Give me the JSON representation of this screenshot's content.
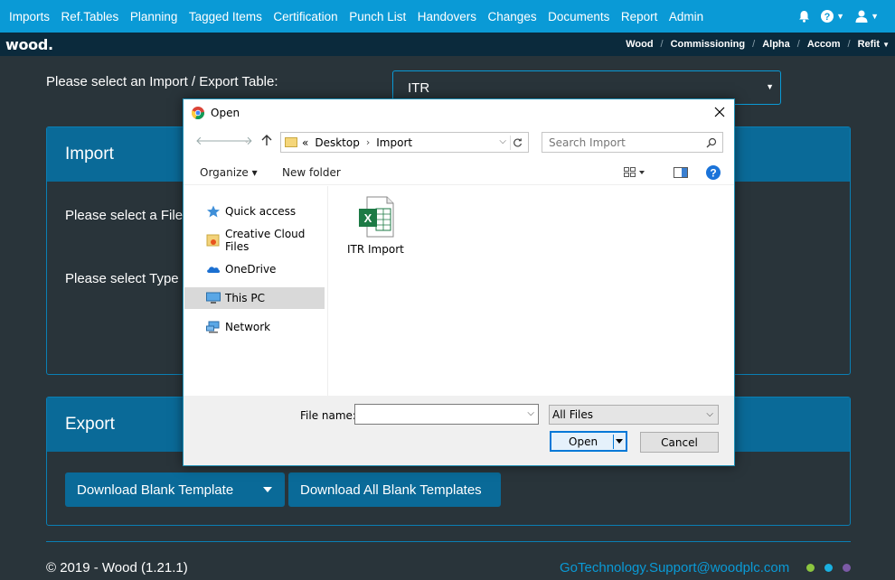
{
  "topnav": {
    "items": [
      "Imports",
      "Ref.Tables",
      "Planning",
      "Tagged Items",
      "Certification",
      "Punch List",
      "Handovers",
      "Changes",
      "Documents",
      "Report",
      "Admin"
    ]
  },
  "subnav": {
    "logo": "wood.",
    "breadcrumbs": [
      "Wood",
      "Commissioning",
      "Alpha",
      "Accom",
      "Refit"
    ]
  },
  "page": {
    "select_label": "Please select an Import / Export Table:",
    "select_value": "ITR",
    "import": {
      "title": "Import",
      "line1": "Please select a File",
      "line2": "Please select Type o"
    },
    "export": {
      "title": "Export",
      "download_blank": "Download Blank Template",
      "download_all": "Download All Blank Templates"
    },
    "footer": {
      "copyright": "© 2019 - Wood (1.21.1)",
      "support_email": "GoTechnology.Support@woodplc.com",
      "dot_colors": [
        "#8cc63f",
        "#1ab0e0",
        "#7b5aa6"
      ]
    }
  },
  "dialog": {
    "title": "Open",
    "address": {
      "prefix": "«",
      "path": [
        "Desktop",
        "Import"
      ]
    },
    "search_placeholder": "Search Import",
    "toolbar": {
      "organize": "Organize ▾",
      "new_folder": "New folder"
    },
    "nav": [
      "Quick access",
      "Creative Cloud Files",
      "OneDrive",
      "This PC",
      "Network"
    ],
    "selected_nav": "This PC",
    "files": [
      {
        "name": "ITR Import",
        "icon": "excel-file-icon"
      }
    ],
    "file_name_label": "File name:",
    "file_name_value": "",
    "filter": "All Files",
    "open_button": "Open",
    "cancel_button": "Cancel"
  },
  "colors": {
    "primary": "#0a9ad6",
    "card_header": "#0a6a98",
    "background": "#29343a",
    "subnav": "#0b2a3c"
  }
}
